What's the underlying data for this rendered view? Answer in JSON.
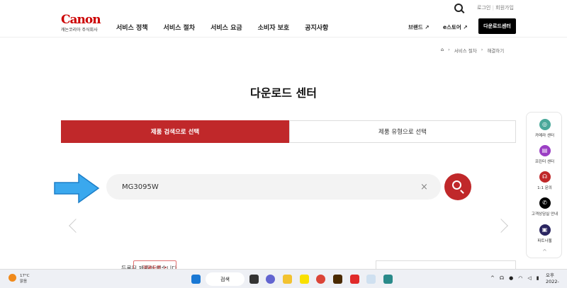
{
  "header": {
    "logo_brand": "Canon",
    "logo_sub": "캐논코리아 주식회사",
    "login": "로그인",
    "signup": "회원가입",
    "separator": "|",
    "nav": [
      "서비스 정책",
      "서비스 절차",
      "서비스 요금",
      "소비자 보호",
      "공지사항"
    ],
    "brand_link": "브랜드 ↗",
    "estore_link": "e스토어 ↗",
    "download_button": "다운로드센터"
  },
  "breadcrumb": [
    "서비스 절차",
    "해결하기"
  ],
  "page_title": "다운로드 센터",
  "tabs": [
    "제품 검색으로 선택",
    "제품 유형으로 선택"
  ],
  "search": {
    "value": "MG3095W",
    "clear": "×"
  },
  "results": {
    "empty_text": "등록된 제품이 없습니다",
    "register_button": "정품등록 ↗"
  },
  "side_menu": [
    "카메라 센터",
    "프린터 센터",
    "1:1 문의",
    "고객상담실 안내",
    "파트너웹"
  ],
  "taskbar": {
    "temp": "17°C",
    "weather": "맑음",
    "search": "검색",
    "clock_top": "오후",
    "clock_date": "2022-"
  },
  "colors": {
    "accent": "#c0282a"
  }
}
